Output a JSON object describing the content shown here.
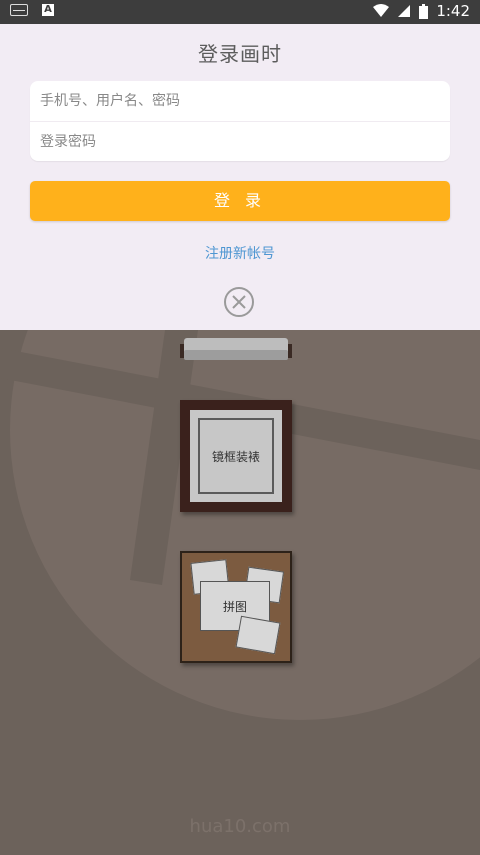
{
  "status_bar": {
    "time": "1:42"
  },
  "login": {
    "title": "登录画时",
    "username_placeholder": "手机号、用户名、密码",
    "password_placeholder": "登录密码",
    "login_button": "登 录",
    "register_link": "注册新帐号"
  },
  "background": {
    "frame_label": "镜框装裱",
    "collage_label": "拼图",
    "watermark": "hua10.com"
  },
  "colors": {
    "accent": "#ffb11b",
    "link": "#4e96d2",
    "panel": "#f2ecf4"
  }
}
